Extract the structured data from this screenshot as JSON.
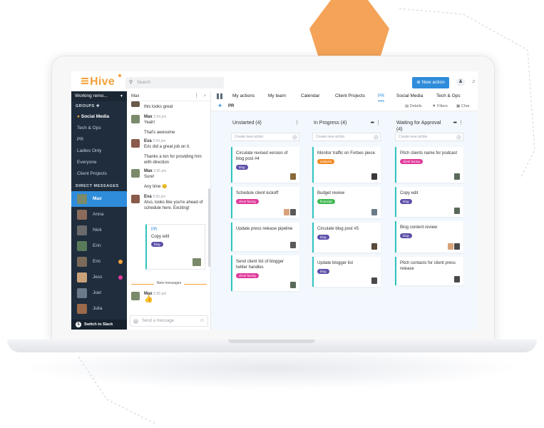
{
  "app": {
    "logo": "Hive",
    "search_placeholder": "Search",
    "new_action_label": "New action",
    "new_action_icon": "plus-icon"
  },
  "sidebar": {
    "workspace": "Working remo...",
    "groups_header": "GROUPS",
    "groups": [
      {
        "label": "Social Media",
        "active": true
      },
      {
        "label": "Tech & Ops"
      },
      {
        "label": "PR"
      },
      {
        "label": "Ladies Only"
      },
      {
        "label": "Everyone"
      },
      {
        "label": "Client Projects"
      }
    ],
    "dm_header": "DIRECT MESSAGES",
    "dms": [
      {
        "label": "Max",
        "selected": true
      },
      {
        "label": "Anna"
      },
      {
        "label": "Nick"
      },
      {
        "label": "Erin"
      },
      {
        "label": "Eric"
      },
      {
        "label": "Jess"
      },
      {
        "label": "Joel"
      },
      {
        "label": "Julia"
      }
    ],
    "switch_label": "Switch to Slack"
  },
  "chat": {
    "title": "Max",
    "messages": [
      {
        "text": "this looks great"
      },
      {
        "author": "Max",
        "time": "5:54 pm",
        "text": "Yeah!"
      },
      {
        "text": "That's awesome"
      },
      {
        "author": "Eva",
        "time": "5:54 pm",
        "text": "Eric did a great job on it."
      },
      {
        "text": "Thanks a ton for providing him with direction"
      },
      {
        "author": "Max",
        "time": "5:55 pm",
        "text": "Sure!"
      },
      {
        "text": "Any time 😊"
      },
      {
        "author": "Eva",
        "time": "5:56 pm",
        "text": "Also, looks like you're ahead of schedule here. Exciting!"
      }
    ],
    "card": {
      "project": "PR",
      "title": "Copy edit",
      "tag": "blog"
    },
    "new_messages_label": "New messages",
    "last": {
      "author": "Max",
      "time": "5:56 pm",
      "text": "👍"
    },
    "input_placeholder": "Send a message"
  },
  "board": {
    "tabs": [
      "My actions",
      "My team",
      "Calendar",
      "Client Projects",
      "PR",
      "Social Media",
      "Tech & Ops"
    ],
    "active_tab": "PR",
    "project": "PR",
    "options": [
      "Details",
      "Filters",
      "Char"
    ],
    "create_placeholder": "Create new action",
    "columns": [
      {
        "title": "Unstarted (4)",
        "cards": [
          {
            "title": "Circulate revised version of blog post #4",
            "tag": "blog",
            "tag_color": "#5b4fa8",
            "avatars": 1
          },
          {
            "title": "Schedule client kickoff",
            "tag": "client facing",
            "tag_color": "#e0399a",
            "avatars": 2
          },
          {
            "title": "Update press release pipeline",
            "avatars": 1
          },
          {
            "title": "Send client list of blogger twitter handles",
            "tag": "client facing",
            "tag_color": "#e0399a",
            "avatars": 1
          }
        ]
      },
      {
        "title": "In Progress (4)",
        "cards": [
          {
            "title": "Monitor traffic on Forbes piece",
            "tag": "analysis",
            "tag_color": "#f08a24",
            "avatars": 1
          },
          {
            "title": "Budget review",
            "tag": "financial",
            "tag_color": "#3fb950",
            "avatars": 1
          },
          {
            "title": "Circulate blog post #5",
            "tag": "blog",
            "tag_color": "#5b4fa8",
            "avatars": 1
          },
          {
            "title": "Update blogger list",
            "tag": "blog",
            "tag_color": "#5b4fa8",
            "avatars": 1
          }
        ]
      },
      {
        "title": "Waiting for Approval (4)",
        "cards": [
          {
            "title": "Pitch clients name for podcast",
            "tag": "client facing",
            "tag_color": "#e0399a",
            "avatars": 1
          },
          {
            "title": "Copy edit",
            "tag": "blog",
            "tag_color": "#5b4fa8",
            "avatars": 1
          },
          {
            "title": "Blog content review",
            "tag": "blog",
            "tag_color": "#5b4fa8",
            "avatars": 2
          },
          {
            "title": "Pitch contacts for client press release",
            "avatars": 1
          }
        ]
      }
    ]
  },
  "colors": {
    "accent": "#2f8cdb",
    "brand": "#f4a13a",
    "sidebar": "#1f2d3d",
    "card_border": "#2fc3c0"
  }
}
